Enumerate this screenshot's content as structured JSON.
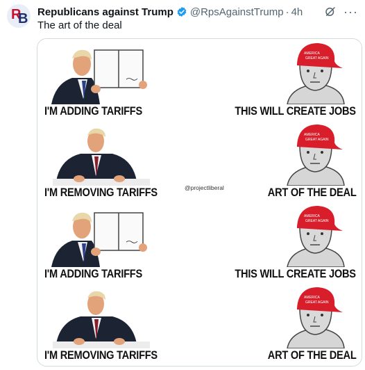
{
  "post": {
    "author_name": "Republicans against Trump",
    "handle": "@RpsAgainstTrump",
    "separator": "·",
    "time": "4h",
    "text": "The art of the deal",
    "avatar_letters": "RB",
    "icons": [
      "verified-badge-icon",
      "grok-icon",
      "more-icon"
    ],
    "colors": {
      "verified": "#1d9bf0",
      "handle": "#536471",
      "maga_hat": "#d81e2b"
    }
  },
  "meme": {
    "watermark": "@projectliberal",
    "hat_text": "AMERICA GREAT AGAIN",
    "panels": [
      {
        "left_caption": "I'M ADDING TARIFFS",
        "right_caption": "THIS WILL CREATE JOBS",
        "pose": "holding-document"
      },
      {
        "left_caption": "I'M REMOVING TARIFFS",
        "right_caption": "ART OF THE DEAL",
        "pose": "signing-at-desk"
      },
      {
        "left_caption": "I'M ADDING TARIFFS",
        "right_caption": "THIS WILL CREATE JOBS",
        "pose": "holding-document"
      },
      {
        "left_caption": "I'M REMOVING TARIFFS",
        "right_caption": "ART OF THE DEAL",
        "pose": "signing-at-desk"
      }
    ]
  }
}
